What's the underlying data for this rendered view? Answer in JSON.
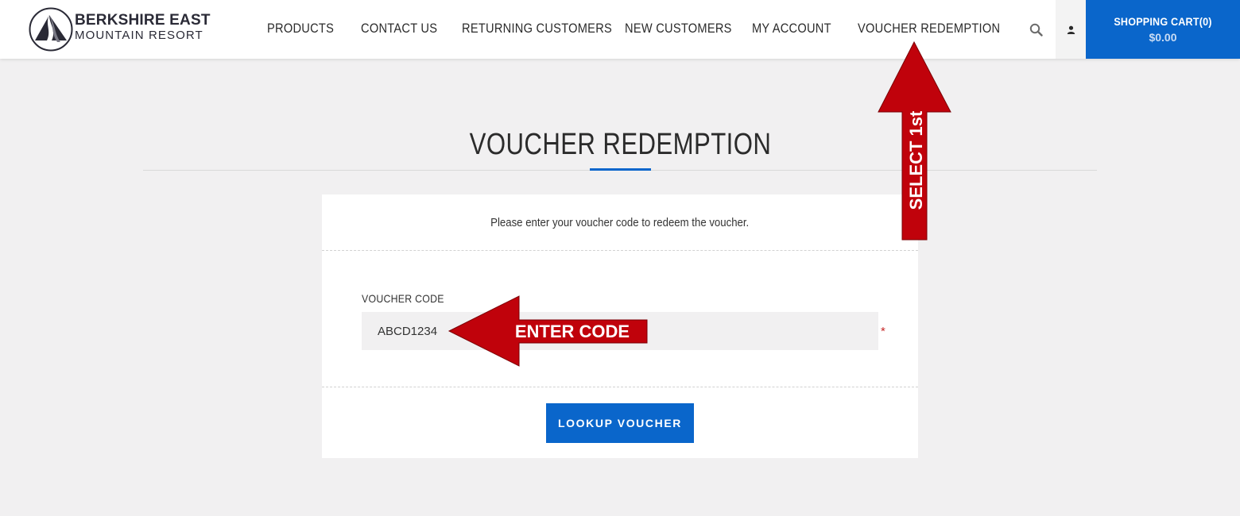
{
  "brand": {
    "line1": "BERKSHIRE EAST",
    "line2": "MOUNTAIN RESORT"
  },
  "nav": {
    "items": [
      "PRODUCTS",
      "CONTACT US",
      "RETURNING CUSTOMERS",
      "NEW CUSTOMERS",
      "MY ACCOUNT",
      "VOUCHER REDEMPTION"
    ]
  },
  "header_icons": {
    "search": "search-icon",
    "account": "user-icon"
  },
  "cart": {
    "title": "SHOPPING CART(0)",
    "total": "$0.00"
  },
  "page": {
    "title": "VOUCHER REDEMPTION"
  },
  "form": {
    "intro": "Please enter your voucher code to redeem the voucher.",
    "label": "VOUCHER CODE",
    "value": "ABCD1234",
    "required_mark": "*",
    "button": "LOOKUP VOUCHER"
  },
  "annotations": {
    "select_first": "SELECT 1st",
    "enter_code": "ENTER CODE"
  },
  "colors": {
    "accent": "#0a66cb",
    "annotation_red": "#c0020b",
    "page_bg": "#f1f0f1"
  }
}
